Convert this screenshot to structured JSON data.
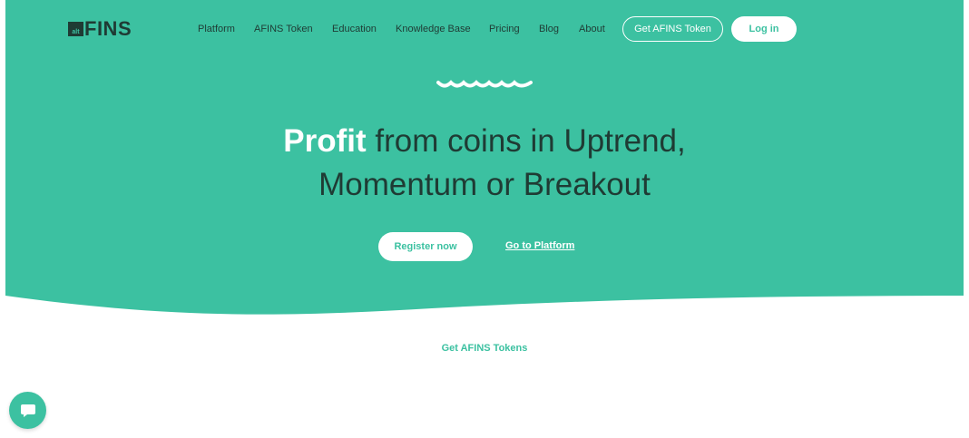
{
  "brand": {
    "logo_badge": "alt",
    "logo_text": "FINS",
    "accent_color": "#3cc1a1",
    "dark_color": "#1f3b34"
  },
  "nav": {
    "items": [
      "Platform",
      "AFINS Token",
      "Education",
      "Knowledge Base",
      "Pricing",
      "Blog",
      "About"
    ],
    "get_token_label": "Get AFINS Token",
    "login_label": "Log in"
  },
  "hero": {
    "headline_strong": "Profit",
    "headline_rest": " from coins in Uptrend,",
    "headline_line2": "Momentum or Breakout",
    "register_label": "Register now",
    "platform_link_label": "Go to Platform",
    "decoration_icon": "waves-icon"
  },
  "section": {
    "get_tokens_label": "Get AFINS Tokens"
  },
  "chat": {
    "icon": "chat-bubble-icon"
  }
}
